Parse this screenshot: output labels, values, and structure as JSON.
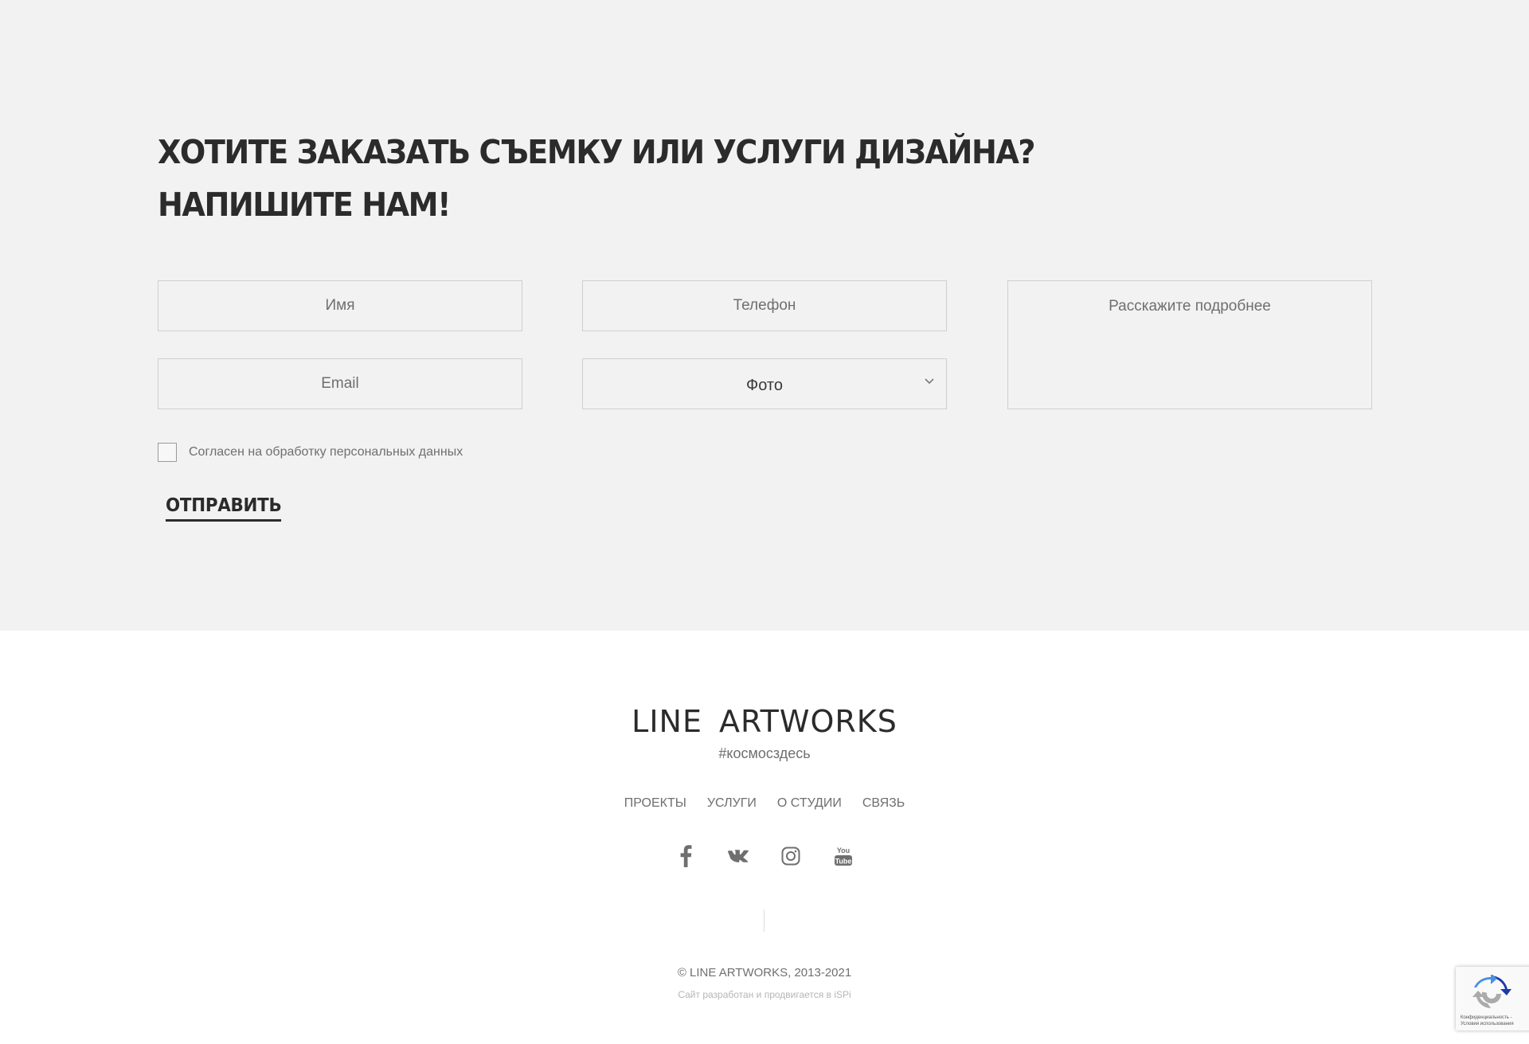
{
  "contact": {
    "heading_line1": "ХОТИТЕ ЗАКАЗАТЬ СЪЕМКУ ИЛИ УСЛУГИ ДИЗАЙНА?",
    "heading_line2": "НАПИШИТЕ НАМ!",
    "fields": {
      "name_placeholder": "Имя",
      "phone_placeholder": "Телефон",
      "email_placeholder": "Email",
      "message_placeholder": "Расскажите подробнее"
    },
    "service_select": {
      "selected": "Фото"
    },
    "consent_label": "Согласен на обработку персональных данных",
    "consent_checked": false,
    "submit_label": "ОТПРАВИТЬ"
  },
  "footer": {
    "logo": "LINE ARTWORKS",
    "tagline": "#космосздесь",
    "nav": [
      "ПРОЕКТЫ",
      "УСЛУГИ",
      "О СТУДИИ",
      "СВЯЗЬ"
    ],
    "social_icons": [
      "facebook-icon",
      "vk-icon",
      "instagram-icon",
      "youtube-icon"
    ],
    "copyright": "© LINE ARTWORKS, 2013-2021",
    "developed_by": "Сайт разработан и продвигается в iSPi"
  },
  "recaptcha": {
    "terms_line1": "Конфиденциальность -",
    "terms_line2": "Условия использования"
  },
  "colors": {
    "section_bg": "#f2f2f2",
    "text_dark": "#2b2b2b",
    "text_muted": "#6f6f6f",
    "border": "#cfcfcf"
  }
}
